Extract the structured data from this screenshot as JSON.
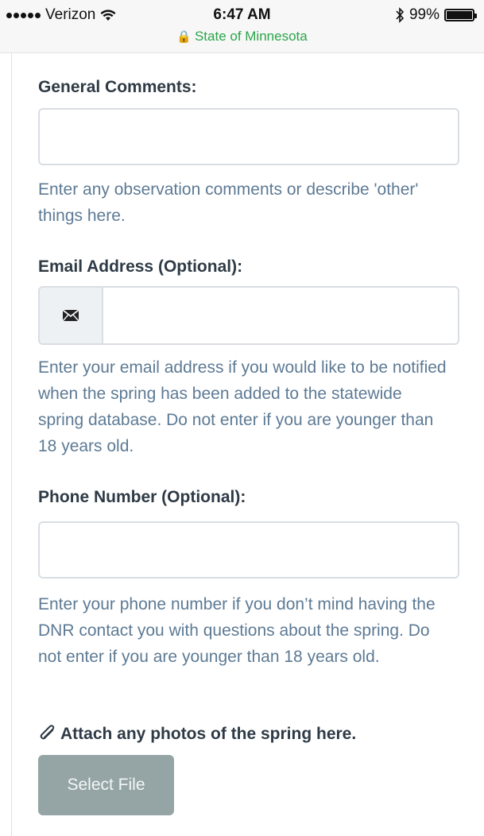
{
  "status_bar": {
    "carrier": "Verizon",
    "time": "6:47 AM",
    "battery": "99%",
    "battery_level": 0.99,
    "site": "State of Minnesota"
  },
  "form": {
    "general_comments": {
      "label": "General Comments:",
      "value": "",
      "help": "Enter any observation comments or describe 'other' things here."
    },
    "email": {
      "label": "Email Address (Optional):",
      "value": "",
      "icon": "envelope-icon",
      "help": "Enter your email address if you would like to be notified when the spring has been added to the statewide spring database. Do not enter if you are younger than 18 years old."
    },
    "phone": {
      "label": "Phone Number (Optional):",
      "value": "",
      "help": "Enter your phone number if you don’t mind having the DNR contact you with questions about the spring. Do not enter if you are younger than 18 years old."
    },
    "attachment": {
      "label": "Attach any photos of the spring here.",
      "icon": "paperclip-icon",
      "button_label": "Select File"
    }
  },
  "colors": {
    "help_text": "#5d7a94",
    "label_text": "#2e3a45",
    "button_bg": "#95a5a6",
    "secure_green": "#2aa54a"
  }
}
